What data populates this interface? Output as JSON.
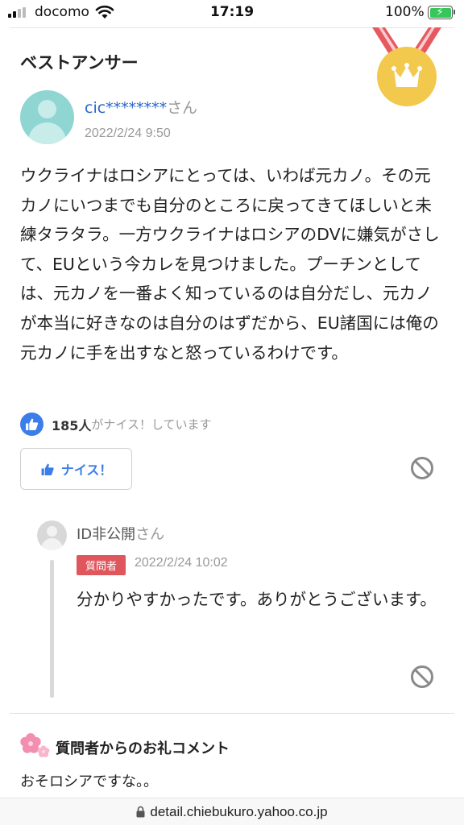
{
  "status_bar": {
    "carrier": "docomo",
    "time": "17:19",
    "battery_percent": "100%",
    "battery_level": 1.0,
    "signal_bars": 2,
    "icons": [
      "signal-icon",
      "wifi-icon",
      "battery-charging-icon"
    ]
  },
  "best_answer": {
    "heading": "ベストアンサー",
    "medal_icon": "gold-crown-medal-icon",
    "user_name": "cic********",
    "honorific": "さん",
    "date": "2022/2/24 9:50",
    "body": "ウクライナはロシアにとっては、いわば元カノ。その元カノにいつまでも自分のところに戻ってきてほしいと未練タラタラ。一方ウクライナはロシアのDVに嫌気がさして、EUという今カレを見つけました。プーチンとしては、元カノを一番よく知っているのは自分だし、元カノが本当に好きなのは自分のはずだから、EU諸国には俺の元カノに手を出すなと怒っているわけです。",
    "like_count": "185人",
    "like_suffix": "がナイス！しています",
    "nice_button_label": "ナイス！"
  },
  "reply": {
    "user_name": "ID非公開",
    "honorific": "さん",
    "role_badge": "質問者",
    "date": "2022/2/24 10:02",
    "body": "分かりやすかったです。ありがとうございます。"
  },
  "thanks": {
    "title": "質問者からのお礼コメント",
    "body": "おそロシアですな。。"
  },
  "url_bar": {
    "url": "detail.chiebukuro.yahoo.co.jp",
    "icon": "lock-icon"
  },
  "colors": {
    "accent_blue": "#3b7de9",
    "link_blue": "#2a66cc",
    "badge_red": "#e0565d",
    "medal_gold": "#f2c94c",
    "avatar_teal": "#8fd6d2"
  }
}
